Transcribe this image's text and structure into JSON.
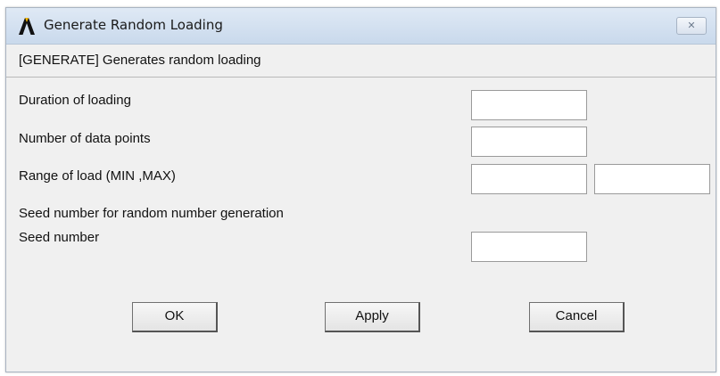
{
  "window": {
    "title": "Generate Random Loading",
    "close_glyph": "✕",
    "icon": "ansys-logo-icon"
  },
  "header": {
    "text": "[GENERATE] Generates random loading"
  },
  "form": {
    "duration_label": "Duration of loading",
    "duration_value": "",
    "points_label": "Number of data points",
    "points_value": "",
    "range_label": "Range of load (MIN ,MAX)",
    "range_min_value": "",
    "range_max_value": "",
    "seed_section_label": "Seed number for random number generation",
    "seed_label": "Seed number",
    "seed_value": ""
  },
  "buttons": {
    "ok": "OK",
    "apply": "Apply",
    "cancel": "Cancel"
  },
  "colors": {
    "titlebar": "#c9d9ec",
    "dialog_bg": "#f0f0f0"
  }
}
